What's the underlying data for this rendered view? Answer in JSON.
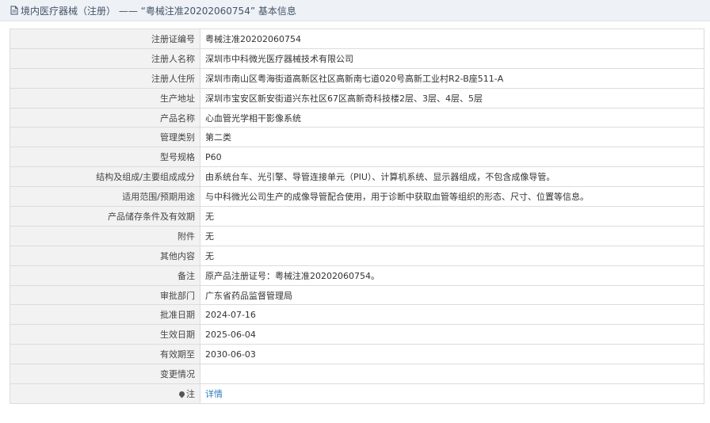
{
  "header": {
    "title": "境内医疗器械（注册） —— “粤械注准20202060754” 基本信息"
  },
  "rows": [
    {
      "label": "注册证编号",
      "value": "粤械注准20202060754"
    },
    {
      "label": "注册人名称",
      "value": "深圳市中科微光医疗器械技术有限公司"
    },
    {
      "label": "注册人住所",
      "value": "深圳市南山区粤海街道高新区社区高新南七道020号高新工业村R2-B座511-A"
    },
    {
      "label": "生产地址",
      "value": "深圳市宝安区新安街道兴东社区67区高新奇科技楼2层、3层、4层、5层"
    },
    {
      "label": "产品名称",
      "value": "心血管光学相干影像系统"
    },
    {
      "label": "管理类别",
      "value": "第二类"
    },
    {
      "label": "型号规格",
      "value": "P60"
    },
    {
      "label": "结构及组成/主要组成成分",
      "value": "由系统台车、光引擎、导管连接单元（PIU）、计算机系统、显示器组成，不包含成像导管。"
    },
    {
      "label": "适用范围/预期用途",
      "value": "与中科微光公司生产的成像导管配合使用，用于诊断中获取血管等组织的形态、尺寸、位置等信息。"
    },
    {
      "label": "产品储存条件及有效期",
      "value": "无"
    },
    {
      "label": "附件",
      "value": "无"
    },
    {
      "label": "其他内容",
      "value": "无"
    },
    {
      "label": "备注",
      "value": "原产品注册证号：粤械注准20202060754。"
    },
    {
      "label": "审批部门",
      "value": "广东省药品监督管理局"
    },
    {
      "label": "批准日期",
      "value": "2024-07-16"
    },
    {
      "label": "生效日期",
      "value": "2025-06-04"
    },
    {
      "label": "有效期至",
      "value": "2030-06-03"
    },
    {
      "label": "变更情况",
      "value": ""
    }
  ],
  "note_row": {
    "label": "注",
    "icon": "map-pin-icon",
    "link_text": "详情"
  },
  "colors": {
    "header_bg": "#eef1f5",
    "label_bg": "#f2f2f2",
    "border": "#dcdcdc",
    "link": "#2f7dc0"
  }
}
